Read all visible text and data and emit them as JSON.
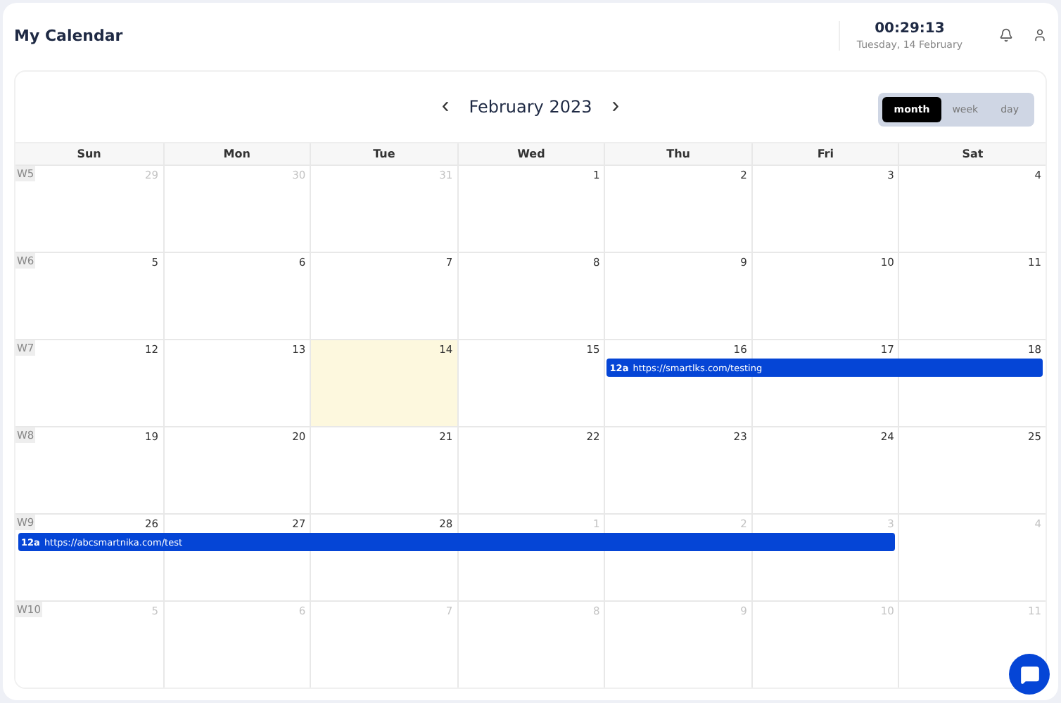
{
  "header": {
    "title": "My Calendar",
    "time": "00:29:13",
    "date": "Tuesday, 14 February"
  },
  "toolbar": {
    "prev": "‹",
    "month": "February 2023",
    "next": "›",
    "views": [
      {
        "label": "month",
        "selected": true
      },
      {
        "label": "week",
        "selected": false
      },
      {
        "label": "day",
        "selected": false
      }
    ]
  },
  "columns": [
    "Sun",
    "Mon",
    "Tue",
    "Wed",
    "Thu",
    "Fri",
    "Sat"
  ],
  "weeks": [
    {
      "label": "W5",
      "days": [
        {
          "number": "29",
          "muted": true,
          "today": false
        },
        {
          "number": "30",
          "muted": true,
          "today": false
        },
        {
          "number": "31",
          "muted": true,
          "today": false
        },
        {
          "number": "1",
          "muted": false,
          "today": false
        },
        {
          "number": "2",
          "muted": false,
          "today": false
        },
        {
          "number": "3",
          "muted": false,
          "today": false
        },
        {
          "number": "4",
          "muted": false,
          "today": false
        }
      ]
    },
    {
      "label": "W6",
      "days": [
        {
          "number": "5",
          "muted": false,
          "today": false
        },
        {
          "number": "6",
          "muted": false,
          "today": false
        },
        {
          "number": "7",
          "muted": false,
          "today": false
        },
        {
          "number": "8",
          "muted": false,
          "today": false
        },
        {
          "number": "9",
          "muted": false,
          "today": false
        },
        {
          "number": "10",
          "muted": false,
          "today": false
        },
        {
          "number": "11",
          "muted": false,
          "today": false
        }
      ]
    },
    {
      "label": "W7",
      "days": [
        {
          "number": "12",
          "muted": false,
          "today": false
        },
        {
          "number": "13",
          "muted": false,
          "today": false
        },
        {
          "number": "14",
          "muted": false,
          "today": true
        },
        {
          "number": "15",
          "muted": false,
          "today": false
        },
        {
          "number": "16",
          "muted": false,
          "today": false
        },
        {
          "number": "17",
          "muted": false,
          "today": false
        },
        {
          "number": "18",
          "muted": false,
          "today": false
        }
      ],
      "events": [
        {
          "time": "12a",
          "title": "https://smartlks.com/testing",
          "covers": [
            false,
            false,
            false,
            false,
            true,
            true,
            true
          ]
        }
      ]
    },
    {
      "label": "W8",
      "days": [
        {
          "number": "19",
          "muted": false,
          "today": false
        },
        {
          "number": "20",
          "muted": false,
          "today": false
        },
        {
          "number": "21",
          "muted": false,
          "today": false
        },
        {
          "number": "22",
          "muted": false,
          "today": false
        },
        {
          "number": "23",
          "muted": false,
          "today": false
        },
        {
          "number": "24",
          "muted": false,
          "today": false
        },
        {
          "number": "25",
          "muted": false,
          "today": false
        }
      ]
    },
    {
      "label": "W9",
      "days": [
        {
          "number": "26",
          "muted": false,
          "today": false
        },
        {
          "number": "27",
          "muted": false,
          "today": false
        },
        {
          "number": "28",
          "muted": false,
          "today": false
        },
        {
          "number": "1",
          "muted": true,
          "today": false
        },
        {
          "number": "2",
          "muted": true,
          "today": false
        },
        {
          "number": "3",
          "muted": true,
          "today": false
        },
        {
          "number": "4",
          "muted": true,
          "today": false
        }
      ],
      "events": [
        {
          "time": "12a",
          "title": "https://abcsmartnika.com/test",
          "covers": [
            true,
            true,
            true,
            true,
            true,
            true,
            false
          ]
        }
      ]
    },
    {
      "label": "W10",
      "days": [
        {
          "number": "5",
          "muted": true,
          "today": false
        },
        {
          "number": "6",
          "muted": true,
          "today": false
        },
        {
          "number": "7",
          "muted": true,
          "today": false
        },
        {
          "number": "8",
          "muted": true,
          "today": false
        },
        {
          "number": "9",
          "muted": true,
          "today": false
        },
        {
          "number": "10",
          "muted": true,
          "today": false
        },
        {
          "number": "11",
          "muted": true,
          "today": false
        }
      ]
    }
  ]
}
